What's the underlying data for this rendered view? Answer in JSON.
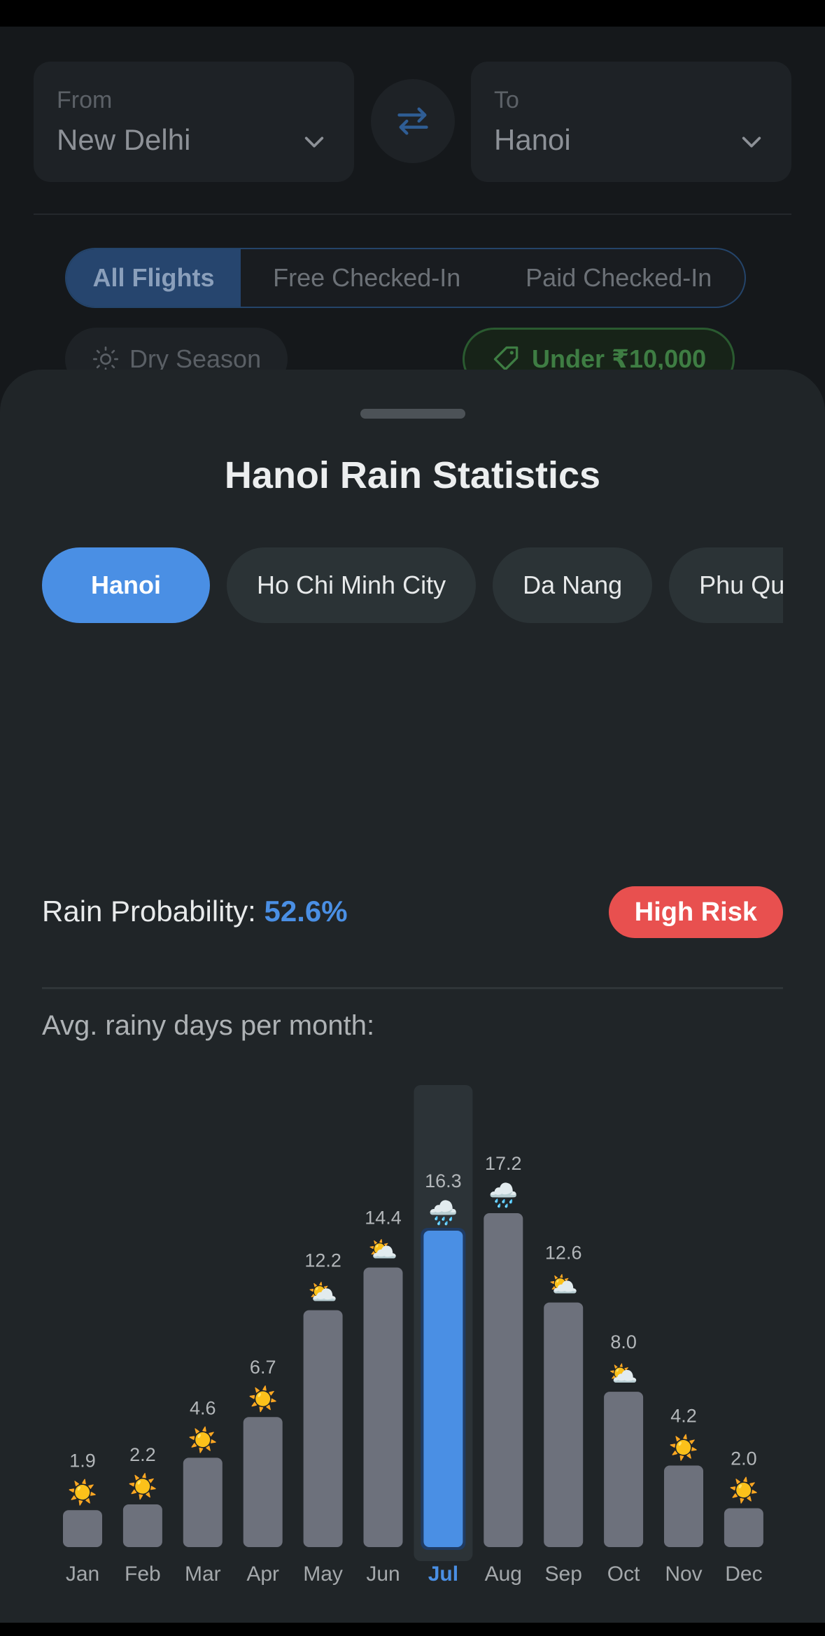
{
  "search": {
    "from_label": "From",
    "from_value": "New Delhi",
    "to_label": "To",
    "to_value": "Hanoi",
    "swap_icon": "swap-arrows-icon"
  },
  "filters": {
    "segments": [
      "All Flights",
      "Free Checked-In",
      "Paid Checked-In"
    ],
    "active_segment": "All Flights",
    "season_chip": "Dry Season",
    "price_chip": "Under ₹10,000"
  },
  "sheet": {
    "title": "Hanoi Rain Statistics",
    "cities": [
      "Hanoi",
      "Ho Chi Minh City",
      "Da Nang",
      "Phu Quoc"
    ],
    "active_city": "Hanoi",
    "probability_label": "Rain Probability:",
    "probability_value": "52.6%",
    "risk_badge": "High Risk",
    "chart_caption": "Avg. rainy days per month:"
  },
  "colors": {
    "accent": "#4a8fe4",
    "bar": "#6d717c",
    "risk": "#e8504f",
    "sheet": "#202528"
  },
  "chart_data": {
    "type": "bar",
    "categories": [
      "Jan",
      "Feb",
      "Mar",
      "Apr",
      "May",
      "Jun",
      "Jul",
      "Aug",
      "Sep",
      "Oct",
      "Nov",
      "Dec"
    ],
    "values": [
      1.9,
      2.2,
      4.6,
      6.7,
      12.2,
      14.4,
      16.3,
      17.2,
      12.6,
      8.0,
      4.2,
      2.0
    ],
    "value_labels": [
      "1.9",
      "2.2",
      "4.6",
      "6.7",
      "12.2",
      "14.4",
      "16.3",
      "17.2",
      "12.6",
      "8.0",
      "4.2",
      "2.0"
    ],
    "icons": [
      "☀️",
      "☀️",
      "☀️",
      "☀️",
      "⛅",
      "⛅",
      "🌧️",
      "🌧️",
      "⛅",
      "⛅",
      "☀️",
      "☀️"
    ],
    "selected": "Jul",
    "ylim": [
      0,
      17.2
    ],
    "grid": false
  }
}
